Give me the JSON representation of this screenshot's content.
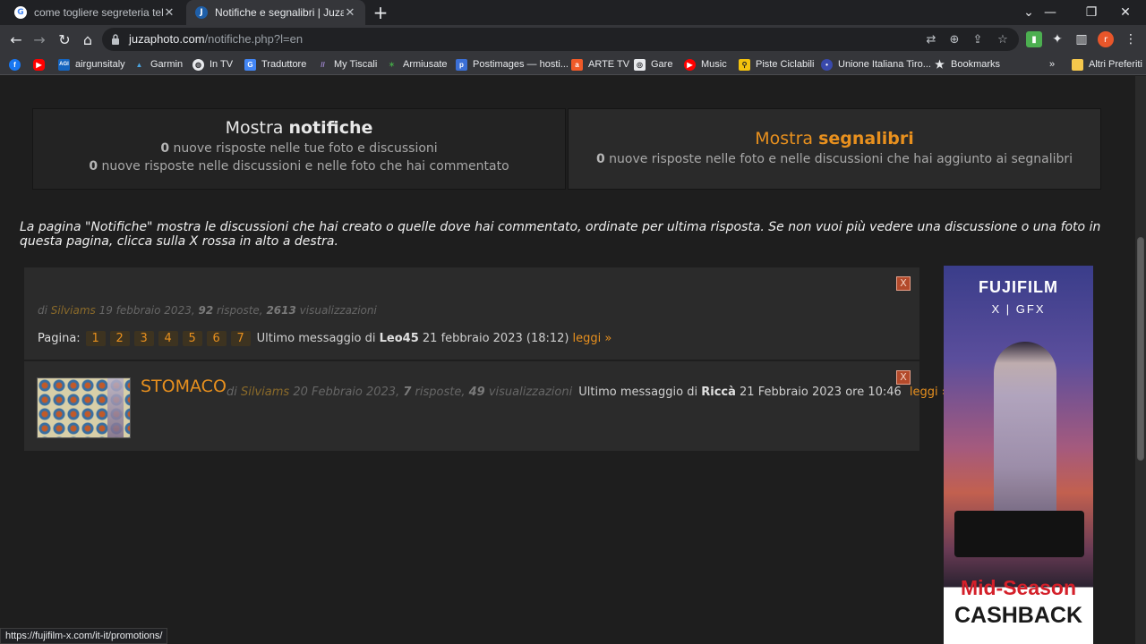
{
  "browser": {
    "tabs": [
      {
        "title": "come togliere segreteria telefonic",
        "icon": "google-icon"
      },
      {
        "title": "Notifiche e segnalibri | JuzaPhoto",
        "icon": "juzaphoto-icon"
      }
    ],
    "url_host": "juzaphoto.com",
    "url_path": "/notifiche.php?l=en",
    "profile_initial": "r",
    "bookmarks": [
      {
        "label": "",
        "icon": "facebook-icon",
        "color": "#1877f2"
      },
      {
        "label": "",
        "icon": "youtube-icon",
        "color": "#ff0000"
      },
      {
        "label": "airgunsitaly",
        "icon": "agi-icon",
        "color": "#1565c0"
      },
      {
        "label": "Garmin",
        "icon": "garmin-icon",
        "color": "#4aa3df"
      },
      {
        "label": "In TV",
        "icon": "globe-icon",
        "color": "#e8eaed"
      },
      {
        "label": "Traduttore",
        "icon": "translate-icon",
        "color": "#4285f4"
      },
      {
        "label": "My Tiscali",
        "icon": "tiscali-icon",
        "color": "#7b5ea7"
      },
      {
        "label": "Armiusate",
        "icon": "armiusate-icon",
        "color": "#2e7d32"
      },
      {
        "label": "Postimages — hosti...",
        "icon": "postimages-icon",
        "color": "#3b6fd6"
      },
      {
        "label": "ARTE TV",
        "icon": "arte-icon",
        "color": "#f05a28"
      },
      {
        "label": "Gare",
        "icon": "gare-icon",
        "color": "#e8eaed"
      },
      {
        "label": "Music",
        "icon": "music-icon",
        "color": "#ff0000"
      },
      {
        "label": "Piste Ciclabili",
        "icon": "piste-icon",
        "color": "#f4c20d"
      },
      {
        "label": "Unione Italiana Tiro...",
        "icon": "uitr-icon",
        "color": "#3949ab"
      },
      {
        "label": "Bookmarks",
        "icon": "star-icon",
        "color": "#e8eaed"
      }
    ],
    "more_bookmarks": "»",
    "other_bookmarks": "Altri Preferiti",
    "status_url": "https://fujifilm-x.com/it-it/promotions/"
  },
  "notifications_panel": {
    "heading_prefix": "Mostra ",
    "heading_bold": "notifiche",
    "line1_count": "0",
    "line1_text": " nuove risposte nelle tue foto e discussioni",
    "line2_count": "0",
    "line2_text": " nuove risposte nelle discussioni e nelle foto che hai commentato"
  },
  "bookmarks_panel": {
    "heading_prefix": "Mostra ",
    "heading_bold": "segnalibri",
    "line1_count": "0",
    "line1_text": " nuove risposte nelle foto e nelle discussioni che hai aggiunto ai segnalibri"
  },
  "intro_text": "La pagina \"Notifiche\" mostra le discussioni che hai creato o quelle dove hai commentato, ordinate per ultima risposta. Se non vuoi più vedere una discussione o una foto in questa pagina, clicca sulla X rossa in alto a destra.",
  "threads": [
    {
      "close_label": "X",
      "by": "di ",
      "author": "Silviams",
      "date": " 19 febbraio 2023, ",
      "replies": "92",
      "replies_label": " risposte, ",
      "views": "2613",
      "views_label": " visualizzazioni",
      "pages_label": "Pagina:",
      "pages": [
        "1",
        "2",
        "3",
        "4",
        "5",
        "6",
        "7"
      ],
      "last_prefix": "Ultimo messaggio di ",
      "last_user": "Leo45",
      "last_date": " 21 febbraio 2023 (18:12)",
      "read": "leggi »"
    },
    {
      "close_label": "X",
      "title": "STOMACO",
      "by": "di ",
      "author": "Silviams",
      "date": " 20 Febbraio 2023, ",
      "replies": "7",
      "replies_label": " risposte, ",
      "views": "49",
      "views_label": " visualizzazioni",
      "last_prefix": "Ultimo messaggio di ",
      "last_user": "Riccà",
      "last_date": " 21 Febbraio 2023 ore 10:46",
      "read": "leggi »"
    }
  ],
  "ad": {
    "brand": "FUJIFILM",
    "sub": "X | GFX",
    "headline": "Mid-Season",
    "subheadline": "CASHBACK"
  },
  "colors": {
    "accent": "#e8901e",
    "close": "#b34a2b",
    "background": "#1e1e1e"
  }
}
